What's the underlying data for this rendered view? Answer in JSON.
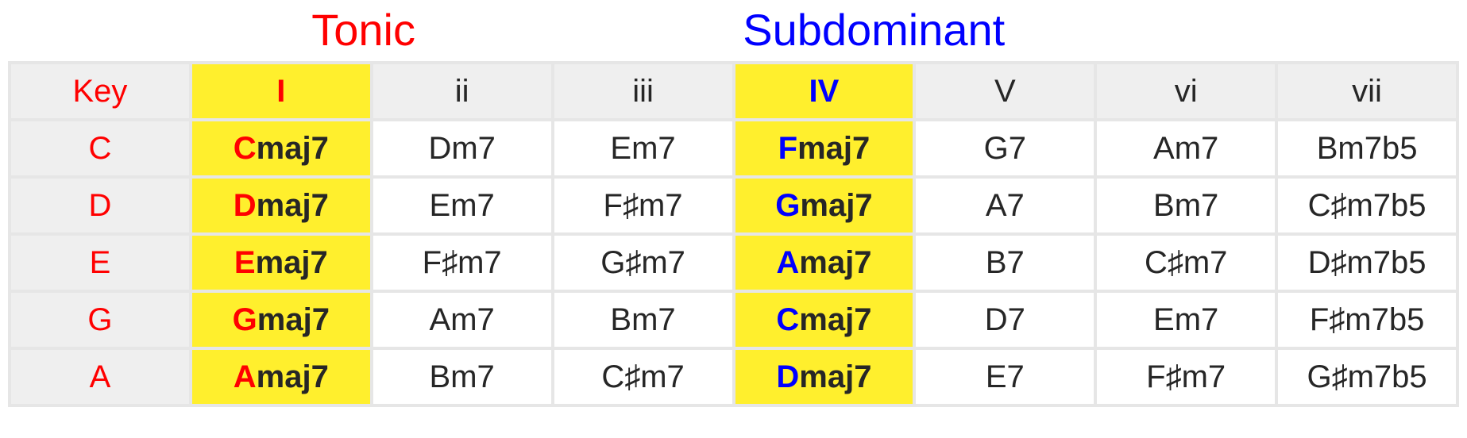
{
  "titles": {
    "tonic": "Tonic",
    "subdominant": "Subdominant"
  },
  "header": {
    "key": "Key",
    "degrees": [
      "I",
      "ii",
      "iii",
      "IV",
      "V",
      "vi",
      "vii"
    ]
  },
  "highlight_columns": [
    0,
    3
  ],
  "tonic_column": 0,
  "subdominant_column": 3,
  "rows": [
    {
      "key": "C",
      "chords": [
        {
          "note": "C",
          "suffix": "maj7"
        },
        {
          "note": "D",
          "suffix": "m7"
        },
        {
          "note": "E",
          "suffix": "m7"
        },
        {
          "note": "F",
          "suffix": "maj7"
        },
        {
          "note": "G",
          "suffix": "7"
        },
        {
          "note": "A",
          "suffix": "m7"
        },
        {
          "note": "B",
          "suffix": "m7b5"
        }
      ]
    },
    {
      "key": "D",
      "chords": [
        {
          "note": "D",
          "suffix": "maj7"
        },
        {
          "note": "E",
          "suffix": "m7"
        },
        {
          "note": "F♯",
          "suffix": "m7"
        },
        {
          "note": "G",
          "suffix": "maj7"
        },
        {
          "note": "A",
          "suffix": "7"
        },
        {
          "note": "B",
          "suffix": "m7"
        },
        {
          "note": "C♯",
          "suffix": "m7b5"
        }
      ]
    },
    {
      "key": "E",
      "chords": [
        {
          "note": "E",
          "suffix": "maj7"
        },
        {
          "note": "F♯",
          "suffix": "m7"
        },
        {
          "note": "G♯",
          "suffix": "m7"
        },
        {
          "note": "A",
          "suffix": "maj7"
        },
        {
          "note": "B",
          "suffix": "7"
        },
        {
          "note": "C♯",
          "suffix": "m7"
        },
        {
          "note": "D♯",
          "suffix": "m7b5"
        }
      ]
    },
    {
      "key": "G",
      "chords": [
        {
          "note": "G",
          "suffix": "maj7"
        },
        {
          "note": "A",
          "suffix": "m7"
        },
        {
          "note": "B",
          "suffix": "m7"
        },
        {
          "note": "C",
          "suffix": "maj7"
        },
        {
          "note": "D",
          "suffix": "7"
        },
        {
          "note": "E",
          "suffix": "m7"
        },
        {
          "note": "F♯",
          "suffix": "m7b5"
        }
      ]
    },
    {
      "key": "A",
      "chords": [
        {
          "note": "A",
          "suffix": "maj7"
        },
        {
          "note": "B",
          "suffix": "m7"
        },
        {
          "note": "C♯",
          "suffix": "m7"
        },
        {
          "note": "D",
          "suffix": "maj7"
        },
        {
          "note": "E",
          "suffix": "7"
        },
        {
          "note": "F♯",
          "suffix": "m7"
        },
        {
          "note": "G♯",
          "suffix": "m7b5"
        }
      ]
    }
  ]
}
